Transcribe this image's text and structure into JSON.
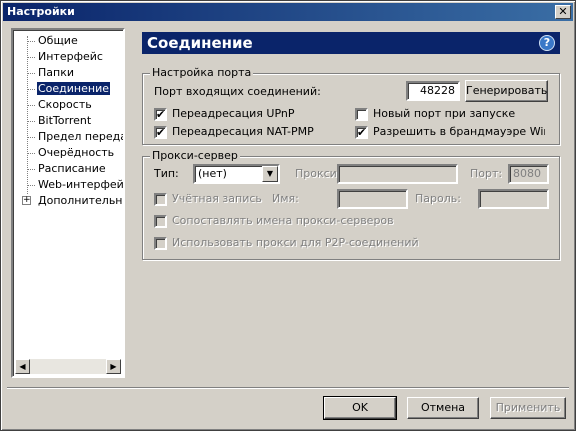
{
  "window": {
    "title": "Настройки",
    "close_glyph": "✕"
  },
  "tree": {
    "items": [
      {
        "label": "Общие",
        "selected": false
      },
      {
        "label": "Интерфейс",
        "selected": false
      },
      {
        "label": "Папки",
        "selected": false
      },
      {
        "label": "Соединение",
        "selected": true
      },
      {
        "label": "Скорость",
        "selected": false
      },
      {
        "label": "BitTorrent",
        "selected": false
      },
      {
        "label": "Предел передачи",
        "selected": false
      },
      {
        "label": "Очерёдность",
        "selected": false
      },
      {
        "label": "Расписание",
        "selected": false
      },
      {
        "label": "Web-интерфейс",
        "selected": false
      },
      {
        "label": "Дополнительно",
        "selected": false,
        "expander": "+"
      }
    ],
    "scroll_left": "◀",
    "scroll_right": "▶"
  },
  "header": {
    "title": "Соединение",
    "help_glyph": "?"
  },
  "port": {
    "group_title": "Настройка порта",
    "incoming_label": "Порт входящих соединений:",
    "port_value": "48228",
    "generate_label": "Генерировать",
    "upnp_label": "Переадресация UPnP",
    "upnp_checked": true,
    "natpmp_label": "Переадресация NAT-PMP",
    "natpmp_checked": true,
    "random_port_label": "Новый порт при запуске",
    "random_port_checked": false,
    "firewall_label": "Разрешить в брандмауэре Windov",
    "firewall_checked": true
  },
  "proxy": {
    "group_title": "Прокси-сервер",
    "type_label": "Тип:",
    "type_value": "(нет)",
    "proxy_label": "Прокси:",
    "proxy_value": "",
    "port_label": "Порт:",
    "port_value": "8080",
    "account_label": "Учётная запись",
    "name_label": "Имя:",
    "password_label": "Пароль:",
    "resolve_names_label": "Сопоставлять имена прокси-серверов",
    "p2p_label": "Использовать прокси для P2P-соединений"
  },
  "buttons": {
    "ok": "OK",
    "cancel": "Отмена",
    "apply": "Применить"
  },
  "check_glyph": "✔",
  "arrow_down_glyph": "▼"
}
